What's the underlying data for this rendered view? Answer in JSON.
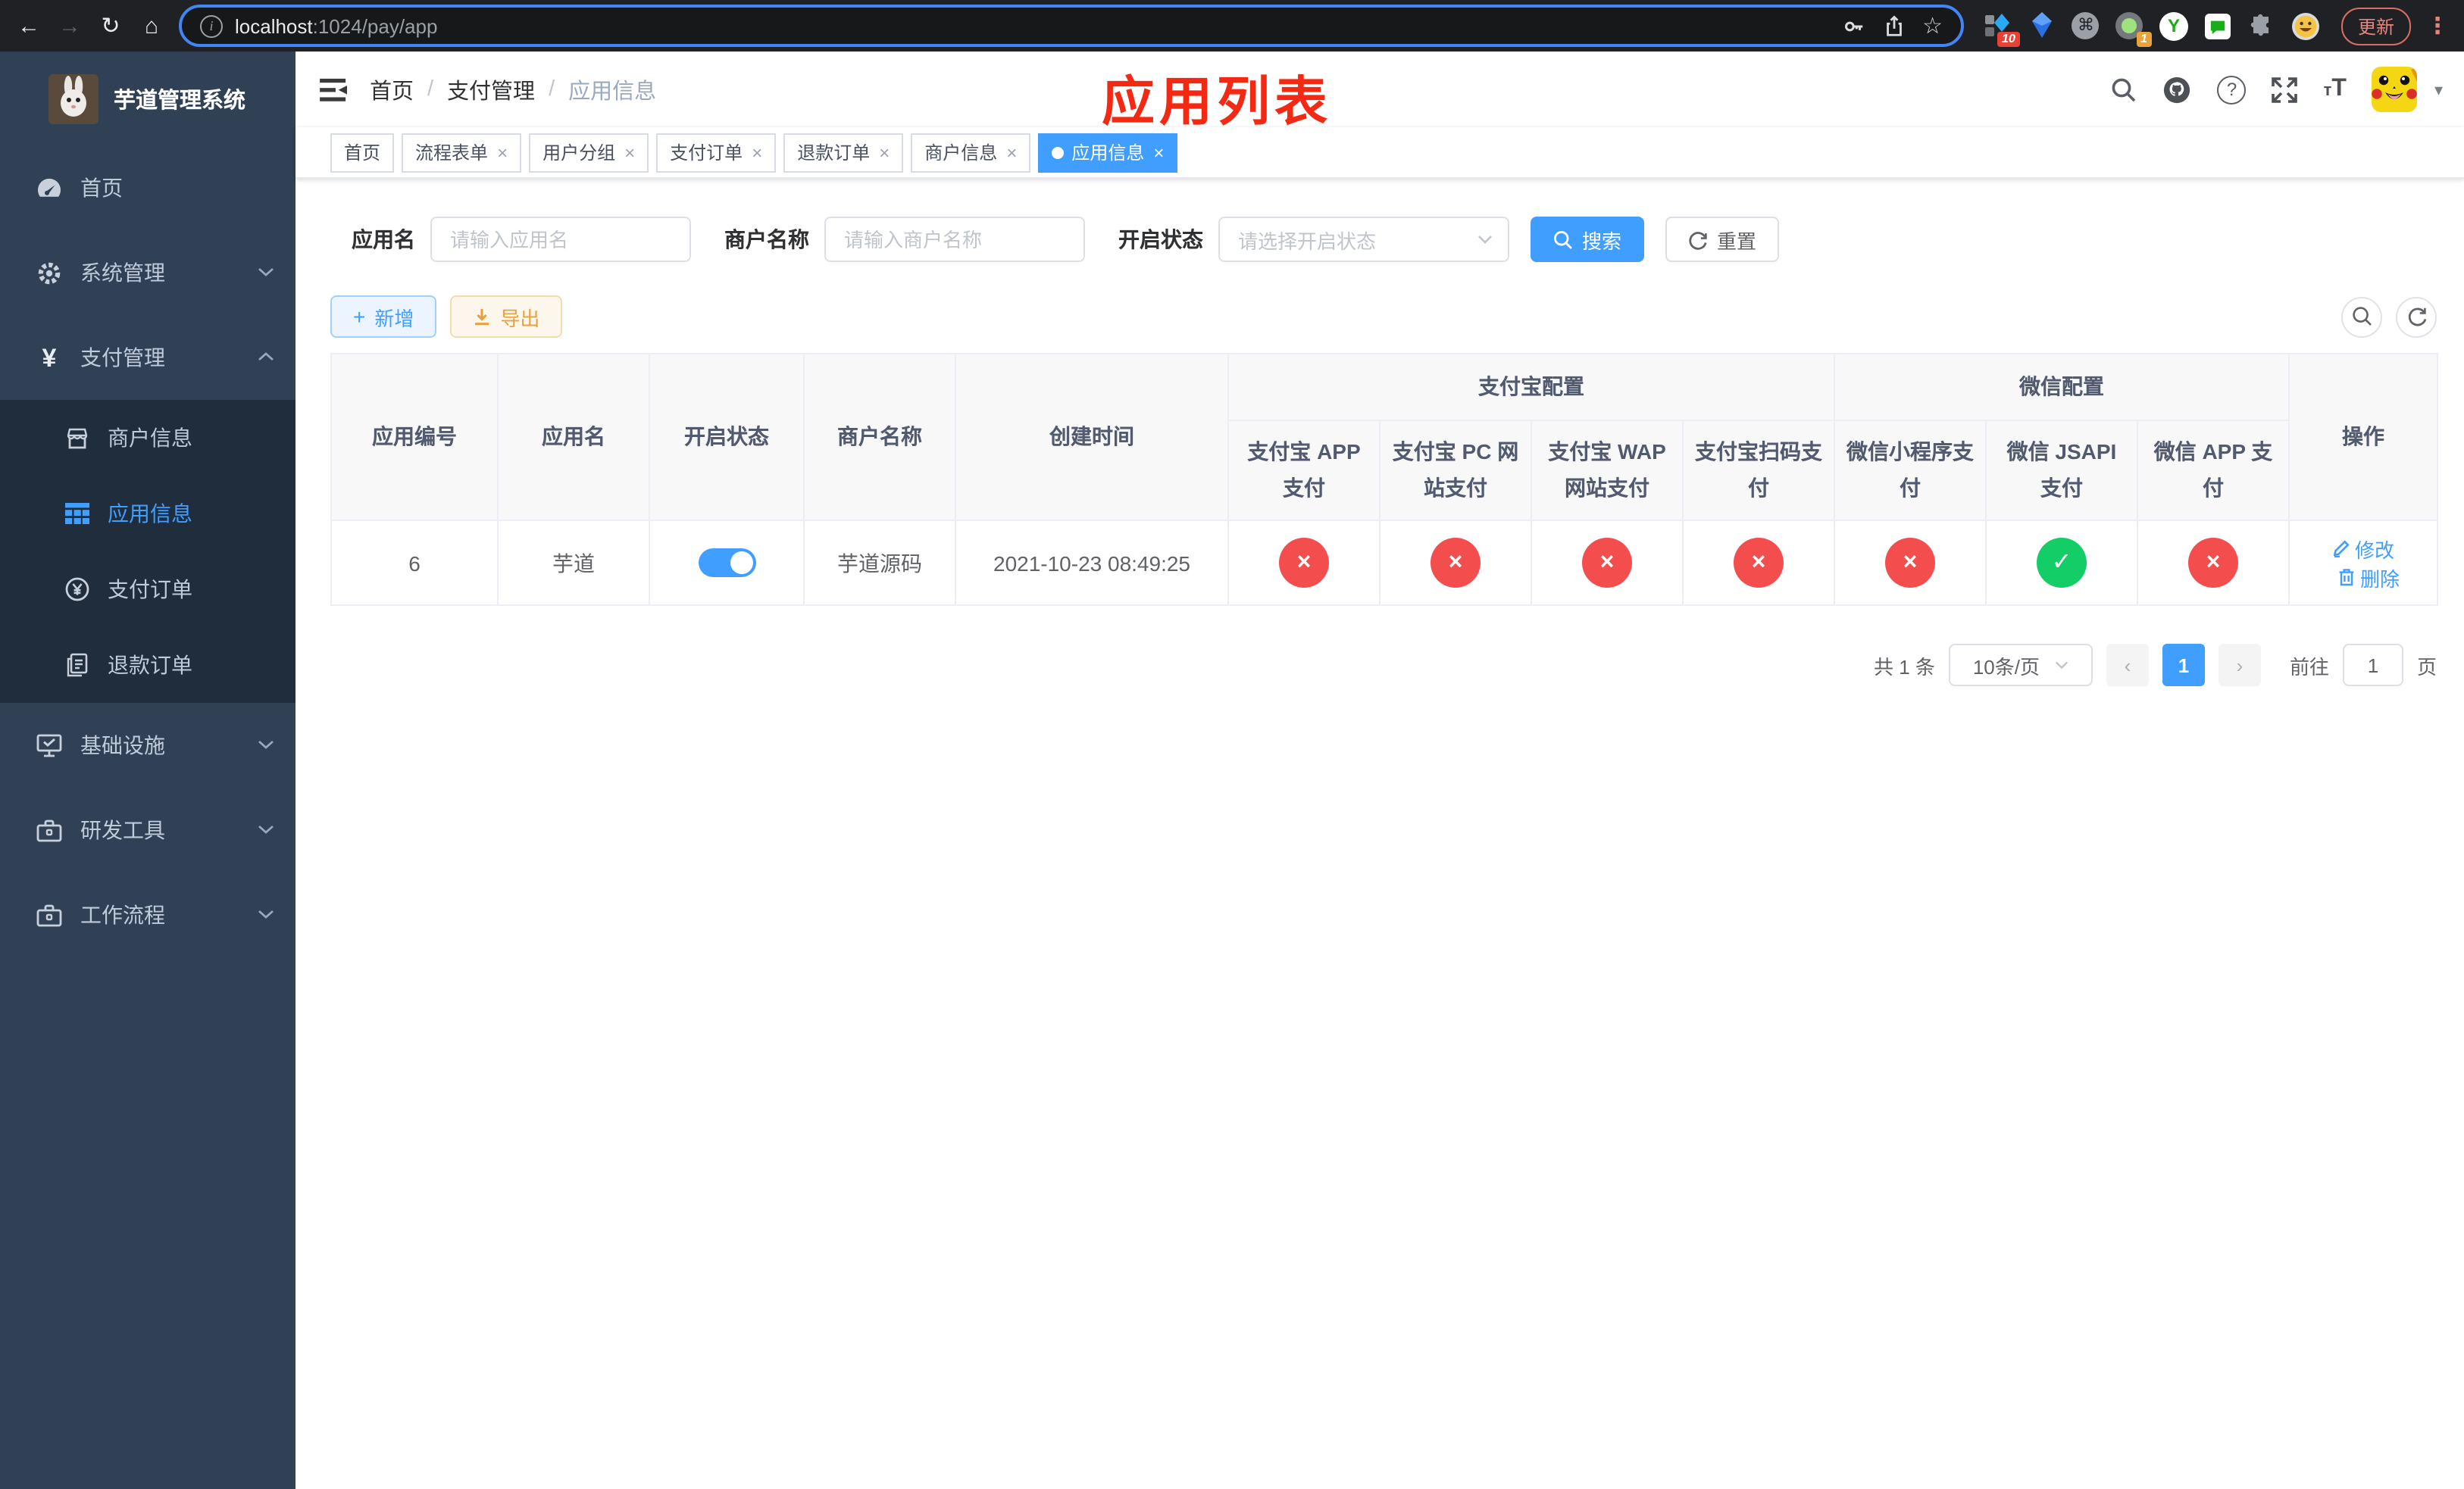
{
  "browser": {
    "url_host": "localhost",
    "url_rest": ":1024/pay/app",
    "update_button": "更新",
    "ext_badge_red": "10",
    "ext_badge_orange": "1"
  },
  "sidebar": {
    "app_title": "芋道管理系统",
    "items": [
      {
        "label": "首页"
      },
      {
        "label": "系统管理"
      },
      {
        "label": "支付管理",
        "children": [
          {
            "label": "商户信息"
          },
          {
            "label": "应用信息"
          },
          {
            "label": "支付订单"
          },
          {
            "label": "退款订单"
          }
        ]
      },
      {
        "label": "基础设施"
      },
      {
        "label": "研发工具"
      },
      {
        "label": "工作流程"
      }
    ]
  },
  "breadcrumb": {
    "items": [
      "首页",
      "支付管理",
      "应用信息"
    ],
    "separator": "/"
  },
  "annotation": "应用列表",
  "tags": [
    {
      "label": "首页",
      "closable": false,
      "active": false
    },
    {
      "label": "流程表单",
      "closable": true,
      "active": false
    },
    {
      "label": "用户分组",
      "closable": true,
      "active": false
    },
    {
      "label": "支付订单",
      "closable": true,
      "active": false
    },
    {
      "label": "退款订单",
      "closable": true,
      "active": false
    },
    {
      "label": "商户信息",
      "closable": true,
      "active": false
    },
    {
      "label": "应用信息",
      "closable": true,
      "active": true
    }
  ],
  "filter": {
    "app_name_label": "应用名",
    "app_name_placeholder": "请输入应用名",
    "merchant_label": "商户名称",
    "merchant_placeholder": "请输入商户名称",
    "status_label": "开启状态",
    "status_placeholder": "请选择开启状态",
    "search_button": "搜索",
    "reset_button": "重置"
  },
  "toolbar": {
    "add_button": "新增",
    "export_button": "导出"
  },
  "table": {
    "col_app_id": "应用编号",
    "col_app_name": "应用名",
    "col_status": "开启状态",
    "col_merchant": "商户名称",
    "col_created": "创建时间",
    "group_alipay": "支付宝配置",
    "group_wechat": "微信配置",
    "channel_cols": [
      "支付宝 APP 支付",
      "支付宝 PC 网站支付",
      "支付宝 WAP 网站支付",
      "支付宝扫码支付",
      "微信小程序支付",
      "微信 JSAPI 支付",
      "微信 APP 支付"
    ],
    "col_ops": "操作",
    "rows": [
      {
        "app_id": "6",
        "app_name": "芋道",
        "enabled": true,
        "merchant": "芋道源码",
        "created": "2021-10-23 08:49:25",
        "channels": [
          false,
          false,
          false,
          false,
          false,
          true,
          false
        ],
        "edit_label": "修改",
        "delete_label": "删除"
      }
    ]
  },
  "pagination": {
    "total": "共 1 条",
    "per_page": "10条/页",
    "page": "1",
    "goto_label": "前往",
    "goto_value": "1",
    "page_unit": "页"
  }
}
